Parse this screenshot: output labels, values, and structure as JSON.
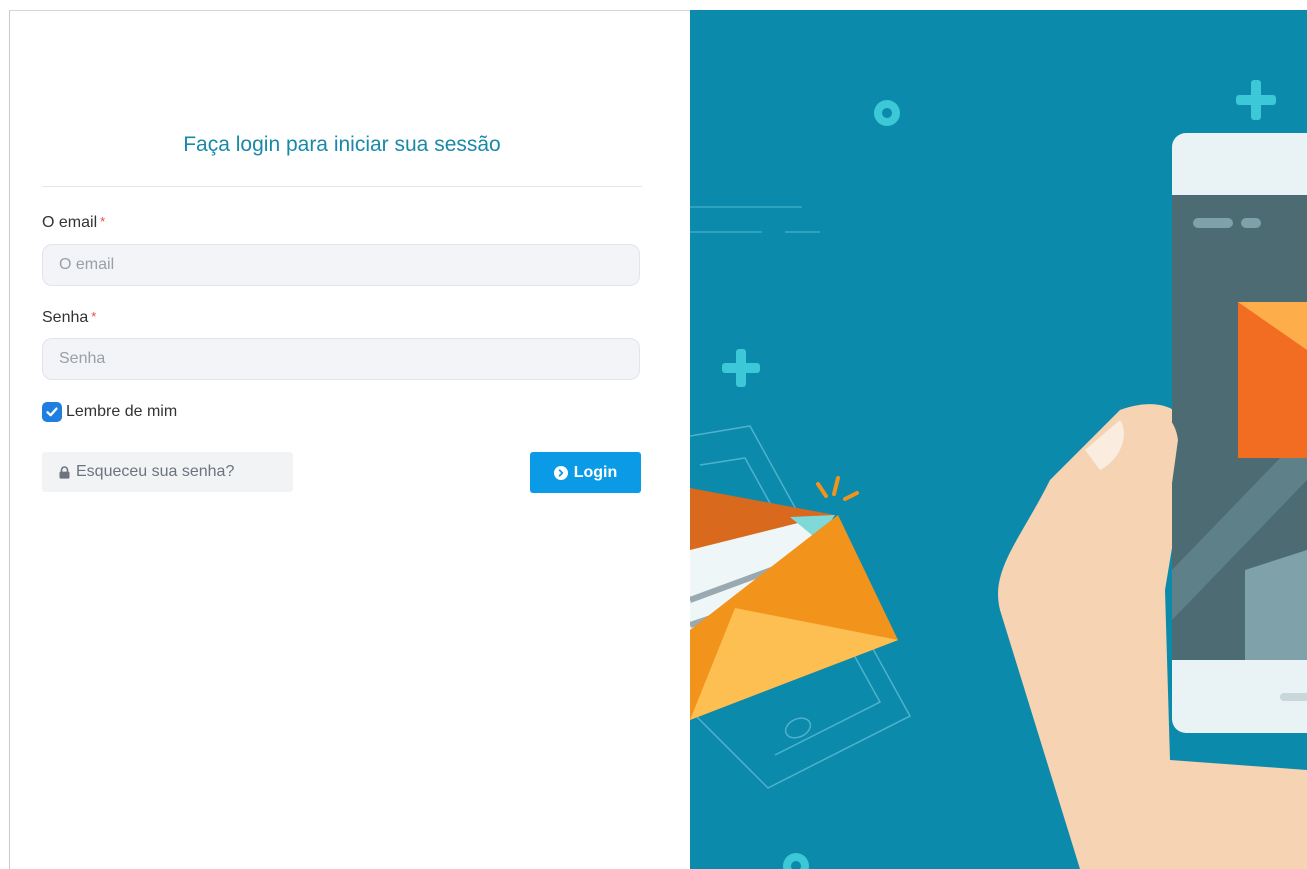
{
  "login": {
    "title": "Faça login para iniciar sua sessão",
    "email_label": "O email",
    "email_placeholder": "O email",
    "password_label": "Senha",
    "password_placeholder": "Senha",
    "required_mark": "*",
    "remember_label": "Lembre de mim",
    "remember_checked": true,
    "forgot_label": "Esqueceu sua senha?",
    "login_label": "Login"
  },
  "icons": {
    "lock": "lock-icon",
    "login_arrow": "chevron-circle-right-icon",
    "checkbox": "check-icon"
  },
  "colors": {
    "accent": "#1a89a8",
    "button": "#0b9be6",
    "illustration_bg": "#0b8aab",
    "required": "#e8493b"
  }
}
